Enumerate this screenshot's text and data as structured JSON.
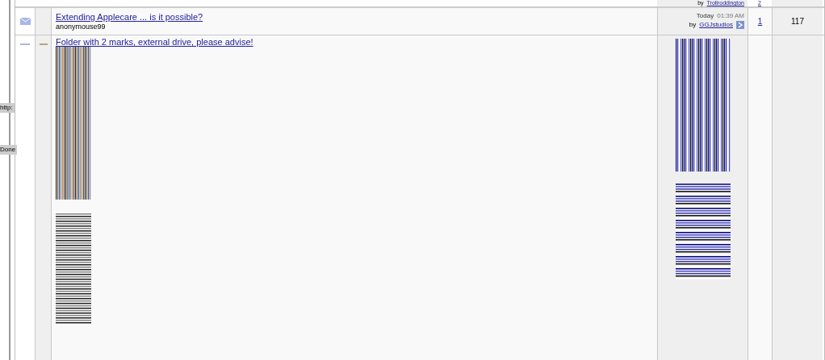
{
  "top_row": {
    "by": "by",
    "last_poster": "Trollroddington",
    "replies": "2"
  },
  "threads": [
    {
      "kind": "full",
      "title": "Extending Applecare ... is it possible?",
      "author": "anonymouse99",
      "date": "Today",
      "time": "01:39 AM",
      "by": "by",
      "last_poster": "GGJstudios",
      "replies": "1",
      "views": "117"
    },
    {
      "kind": "glitched",
      "title": "Folder with 2 marks, external drive, please advise!"
    }
  ],
  "status_labels": [
    "http:",
    "Done"
  ]
}
